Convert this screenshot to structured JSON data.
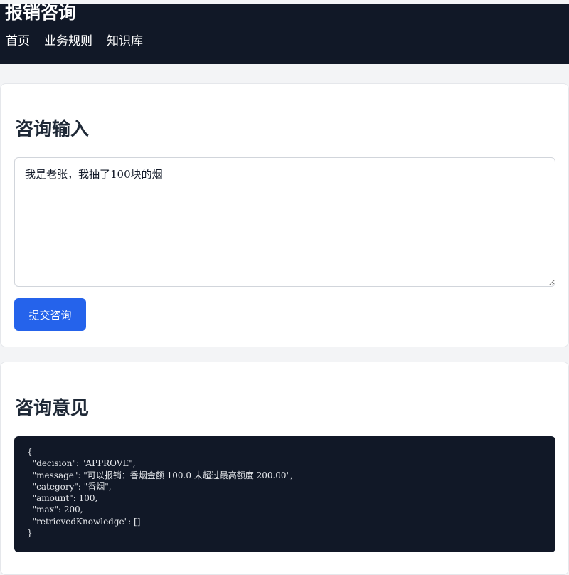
{
  "header": {
    "title": "报销咨询",
    "nav": [
      {
        "label": "首页"
      },
      {
        "label": "业务规则"
      },
      {
        "label": "知识库"
      }
    ]
  },
  "input_section": {
    "title": "咨询输入",
    "textarea_value": "我是老张，我抽了100块的烟",
    "submit_label": "提交咨询"
  },
  "result_section": {
    "title": "咨询意见",
    "json_text": "{\n  \"decision\": \"APPROVE\",\n  \"message\": \"可以报销：香烟金额 100.0 未超过最高额度 200.00\",\n  \"category\": \"香烟\",\n  \"amount\": 100,\n  \"max\": 200,\n  \"retrievedKnowledge\": []\n}"
  },
  "colors": {
    "header_bg": "#111827",
    "accent": "#2563eb",
    "page_bg": "#f3f4f6",
    "code_bg": "#111827"
  }
}
